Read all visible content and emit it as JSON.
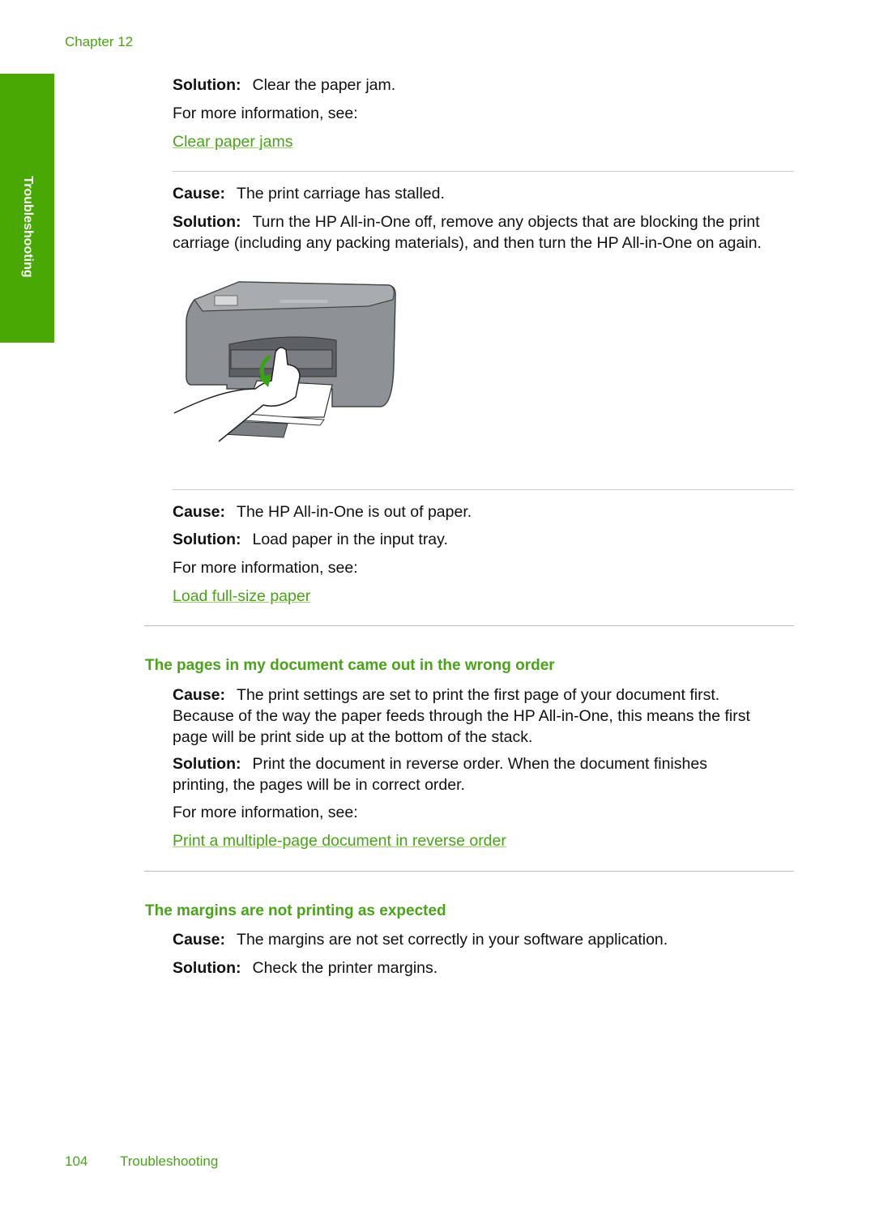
{
  "header": {
    "chapter": "Chapter 12"
  },
  "side_tab": {
    "label": "Troubleshooting",
    "color": "#4aa805"
  },
  "block1": {
    "solution_label": "Solution:",
    "solution_text": "Clear the paper jam.",
    "more_info": "For more information, see:",
    "link": "Clear paper jams"
  },
  "block2": {
    "cause_label": "Cause:",
    "cause_text": "The print carriage has stalled.",
    "solution_label": "Solution:",
    "solution_line1": "Turn the HP All-in-One off, remove any objects that are blocking the print",
    "solution_line2": "carriage (including any packing materials), and then turn the HP All-in-One on again."
  },
  "figure": {
    "description": "Hand removing objects from print carriage of HP All-in-One"
  },
  "block3": {
    "cause_label": "Cause:",
    "cause_text": "The HP All-in-One is out of paper.",
    "solution_label": "Solution:",
    "solution_text": "Load paper in the input tray.",
    "more_info": "For more information, see:",
    "link": "Load full-size paper"
  },
  "section_order": {
    "heading": "The pages in my document came out in the wrong order",
    "cause_label": "Cause:",
    "cause_line1": "The print settings are set to print the first page of your document first.",
    "cause_line2": "Because of the way the paper feeds through the HP All-in-One, this means the first",
    "cause_line3": "page will be print side up at the bottom of the stack.",
    "solution_label": "Solution:",
    "solution_line1": "Print the document in reverse order. When the document finishes",
    "solution_line2": "printing, the pages will be in correct order.",
    "more_info": "For more information, see:",
    "link": "Print a multiple-page document in reverse order"
  },
  "section_margins": {
    "heading": "The margins are not printing as expected",
    "cause_label": "Cause:",
    "cause_text": "The margins are not set correctly in your software application.",
    "solution_label": "Solution:",
    "solution_text": "Check the printer margins."
  },
  "footer": {
    "page_number": "104",
    "title": "Troubleshooting"
  }
}
